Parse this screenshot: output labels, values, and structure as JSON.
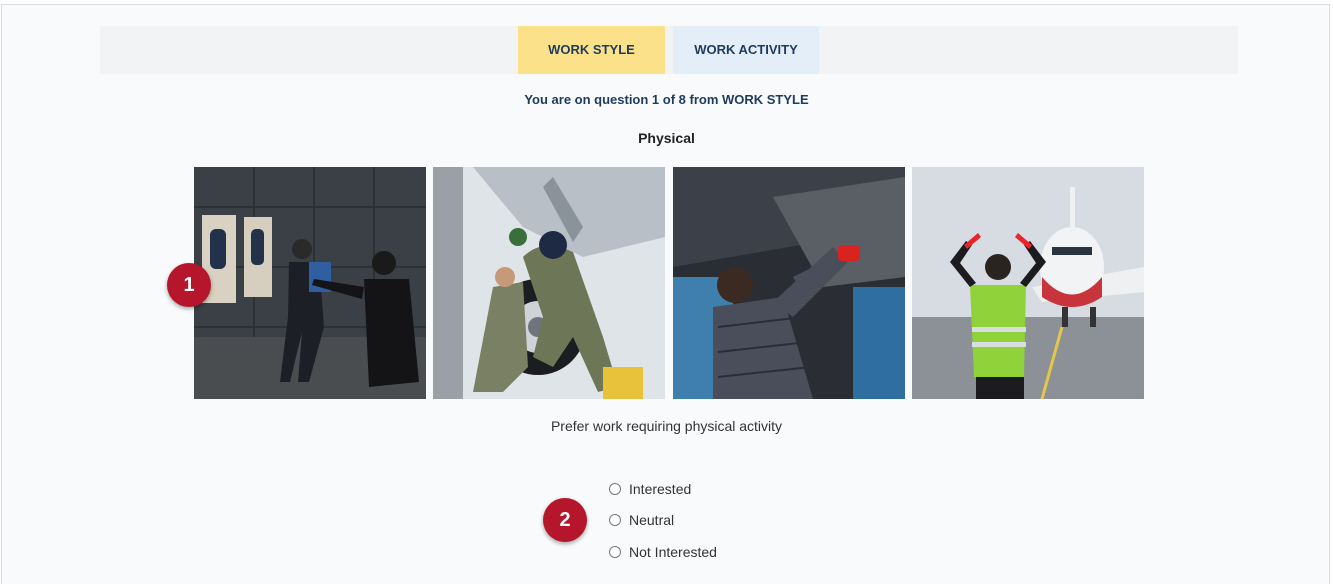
{
  "tabs": [
    {
      "label": "WORK STYLE",
      "active": true,
      "color": "#fbe28a"
    },
    {
      "label": "WORK ACTIVITY",
      "active": false,
      "color": "#e3eef8"
    }
  ],
  "progress_text": "You are on question 1 of 8 from WORK STYLE",
  "category": "Physical",
  "photos": [
    {
      "icon": "police-firearms-training-photo"
    },
    {
      "icon": "sailors-changing-aircraft-tire-photo"
    },
    {
      "icon": "mechanic-working-under-car-photo"
    },
    {
      "icon": "aircraft-marshaller-photo"
    }
  ],
  "badges": [
    "1",
    "2"
  ],
  "statement": "Prefer work requiring physical activity",
  "options": [
    {
      "label": "Interested",
      "checked": false
    },
    {
      "label": "Neutral",
      "checked": false
    },
    {
      "label": "Not Interested",
      "checked": false
    }
  ],
  "colors": {
    "accent_badge": "#b5162b",
    "heading": "#1f3b5c"
  }
}
